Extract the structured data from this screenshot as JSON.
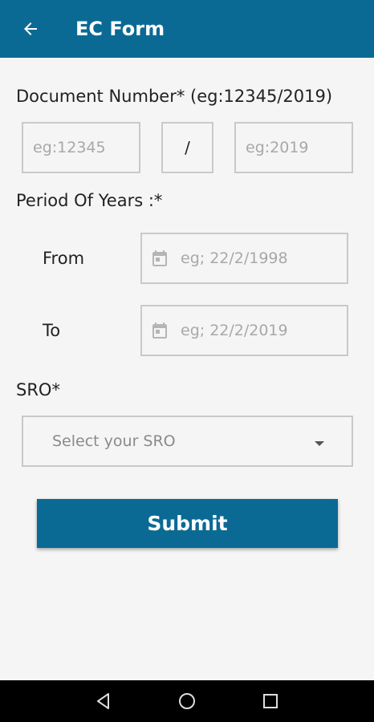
{
  "appbar": {
    "title": "EC Form",
    "back_icon": "arrow-left-icon"
  },
  "document": {
    "label": "Document Number* (eg:12345/2019)",
    "number_placeholder": "eg:12345",
    "separator": "/",
    "year_placeholder": "eg:2019"
  },
  "period": {
    "label": "Period Of Years :*",
    "from_label": "From",
    "from_placeholder": "eg; 22/2/1998",
    "to_label": "To",
    "to_placeholder": "eg; 22/2/2019",
    "date_icon": "calendar-icon"
  },
  "sro": {
    "label": "SRO*",
    "placeholder": "Select your SRO"
  },
  "submit_label": "Submit",
  "colors": {
    "primary": "#0b6a94",
    "background": "#f5f5f5",
    "border": "#c9c9c9"
  },
  "navbar": {
    "icons": [
      "back-triangle-icon",
      "home-circle-icon",
      "recents-square-icon"
    ]
  }
}
